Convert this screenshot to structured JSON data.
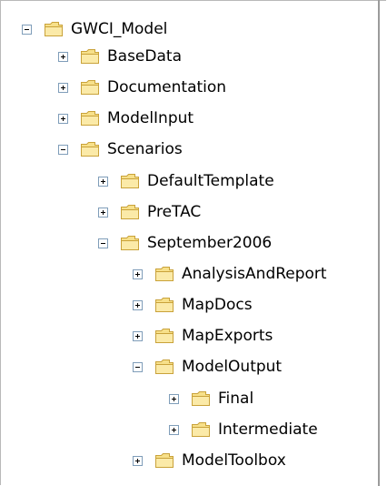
{
  "tree": {
    "items": [
      {
        "label": "GWCI_Model",
        "level": 0,
        "expanded": true
      },
      {
        "label": "BaseData",
        "level": 1,
        "expanded": false
      },
      {
        "label": "Documentation",
        "level": 1,
        "expanded": false
      },
      {
        "label": "ModelInput",
        "level": 1,
        "expanded": false
      },
      {
        "label": "Scenarios",
        "level": 1,
        "expanded": true
      },
      {
        "label": "DefaultTemplate",
        "level": 2,
        "expanded": false
      },
      {
        "label": "PreTAC",
        "level": 2,
        "expanded": false
      },
      {
        "label": "September2006",
        "level": 2,
        "expanded": true
      },
      {
        "label": "AnalysisAndReport",
        "level": 3,
        "expanded": false
      },
      {
        "label": "MapDocs",
        "level": 3,
        "expanded": false
      },
      {
        "label": "MapExports",
        "level": 3,
        "expanded": false
      },
      {
        "label": "ModelOutput",
        "level": 3,
        "expanded": true
      },
      {
        "label": "Final",
        "level": 4,
        "expanded": false
      },
      {
        "label": "Intermediate",
        "level": 4,
        "expanded": false
      },
      {
        "label": "ModelToolbox",
        "level": 3,
        "expanded": false
      }
    ]
  },
  "icons": {
    "toggle_expanded": "minus-box-icon",
    "toggle_collapsed": "plus-box-icon",
    "folder": "folder-icon"
  },
  "colors": {
    "folder_fill": "#f7e08a",
    "folder_stroke": "#c9a23a",
    "toggle_border": "#7f9db9"
  }
}
